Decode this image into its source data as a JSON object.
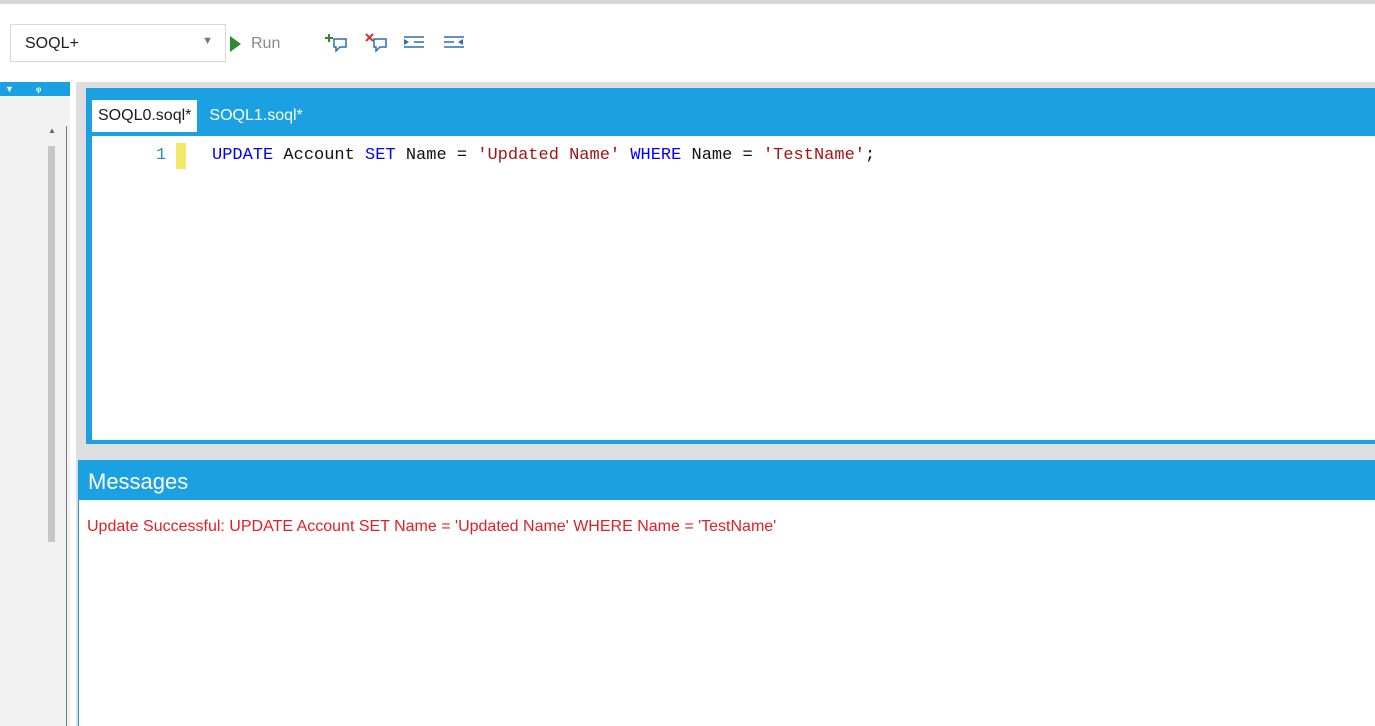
{
  "toolbar": {
    "mode_select": "SOQL+",
    "run_label": "Run",
    "icons": [
      "run-icon",
      "add-comment-icon",
      "remove-comment-icon",
      "indent-icon",
      "outdent-icon"
    ]
  },
  "side_dock": {
    "icons": [
      "collapse-arrow-icon",
      "pin-icon"
    ]
  },
  "editor": {
    "tabs": [
      {
        "label": "SOQL0.soql*",
        "active": true
      },
      {
        "label": "SOQL1.soql*",
        "active": false
      }
    ],
    "line_number": "1",
    "code_tokens": [
      {
        "text": "UPDATE",
        "type": "kw"
      },
      {
        "text": " Account ",
        "type": "plain"
      },
      {
        "text": "SET",
        "type": "kw"
      },
      {
        "text": " Name ",
        "type": "plain"
      },
      {
        "text": "=",
        "type": "op"
      },
      {
        "text": " ",
        "type": "plain"
      },
      {
        "text": "'Updated Name'",
        "type": "str"
      },
      {
        "text": " ",
        "type": "plain"
      },
      {
        "text": "WHERE",
        "type": "kw"
      },
      {
        "text": " Name ",
        "type": "plain"
      },
      {
        "text": "=",
        "type": "op"
      },
      {
        "text": " ",
        "type": "plain"
      },
      {
        "text": "'TestName'",
        "type": "str"
      },
      {
        "text": ";",
        "type": "plain"
      }
    ]
  },
  "messages": {
    "title": "Messages",
    "lines": [
      "Update Successful: UPDATE Account SET Name = 'Updated Name' WHERE Name = 'TestName'"
    ]
  },
  "colors": {
    "accent": "#1ba1e2",
    "keyword": "#0000ff",
    "string": "#a31515",
    "error_text": "#e31e24",
    "run_green": "#2f8a2f"
  }
}
